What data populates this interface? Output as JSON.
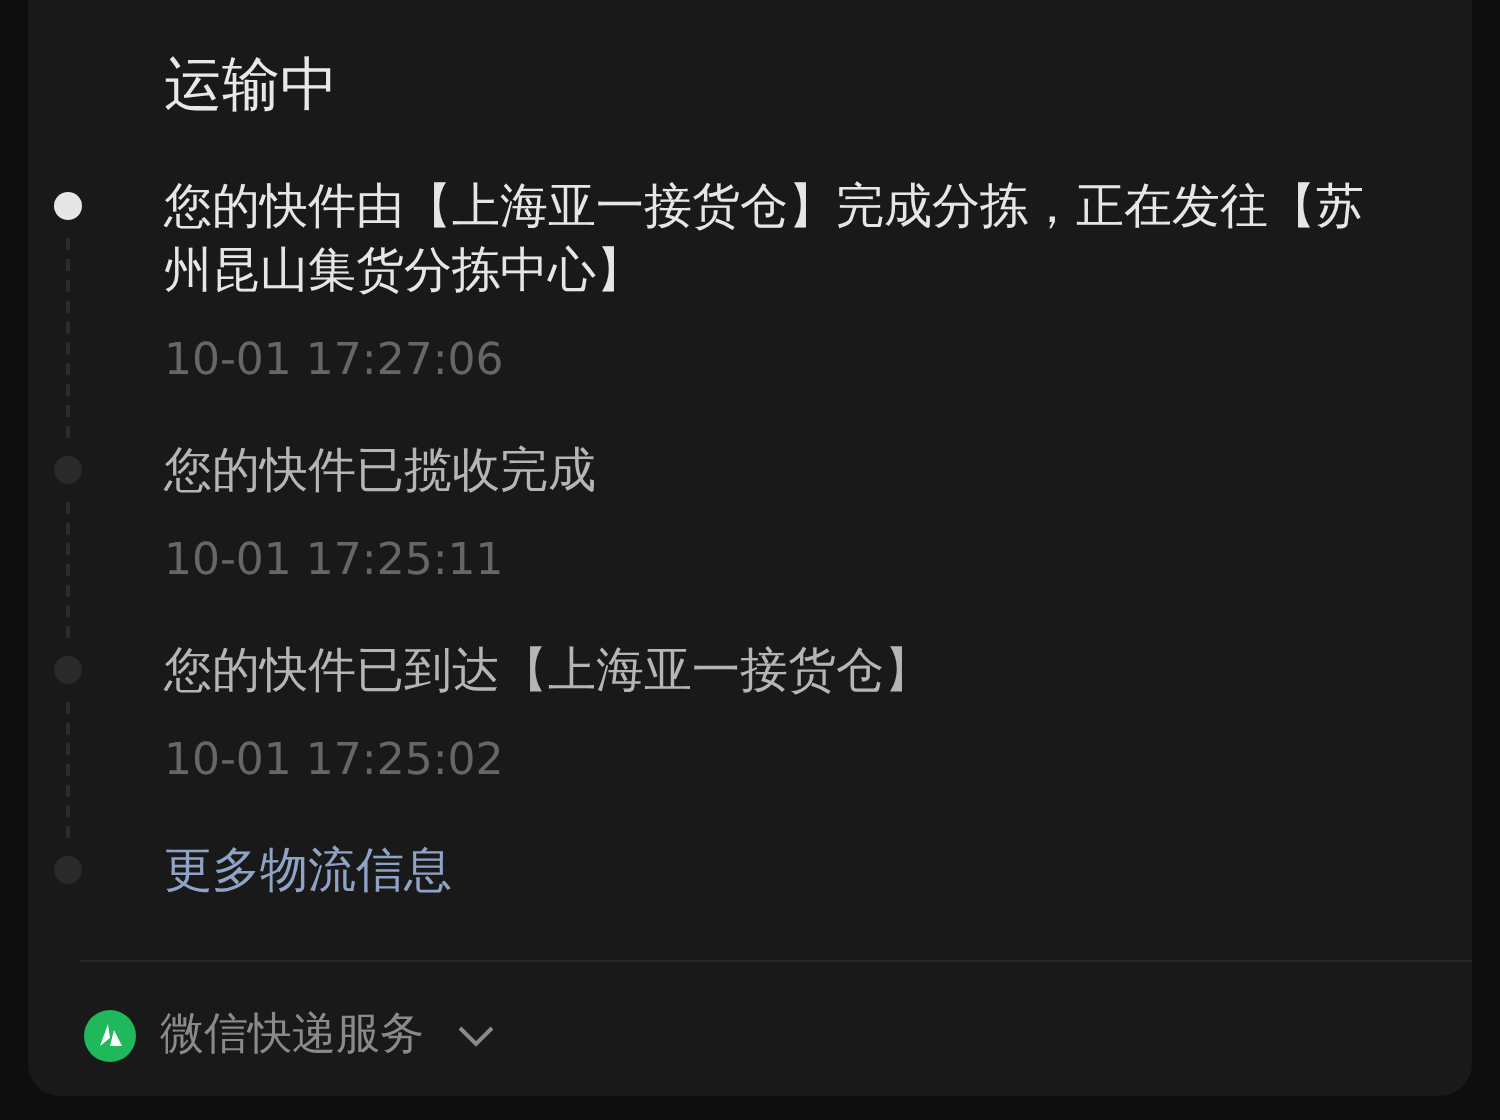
{
  "status_title": "运输中",
  "timeline": [
    {
      "kind": "event",
      "text": "您的快件由【上海亚一接货仓】完成分拣，正在发往【苏州昆山集货分拣中心】",
      "time": "10-01 17:27:06",
      "selected": true
    },
    {
      "kind": "event",
      "text": "您的快件已揽收完成",
      "time": "10-01 17:25:11",
      "selected": false
    },
    {
      "kind": "event",
      "text": "您的快件已到达【上海亚一接货仓】",
      "time": "10-01 17:25:02",
      "selected": false
    },
    {
      "kind": "link",
      "text": "更多物流信息",
      "selected": false
    }
  ],
  "footer": {
    "service": "微信快递服务"
  }
}
